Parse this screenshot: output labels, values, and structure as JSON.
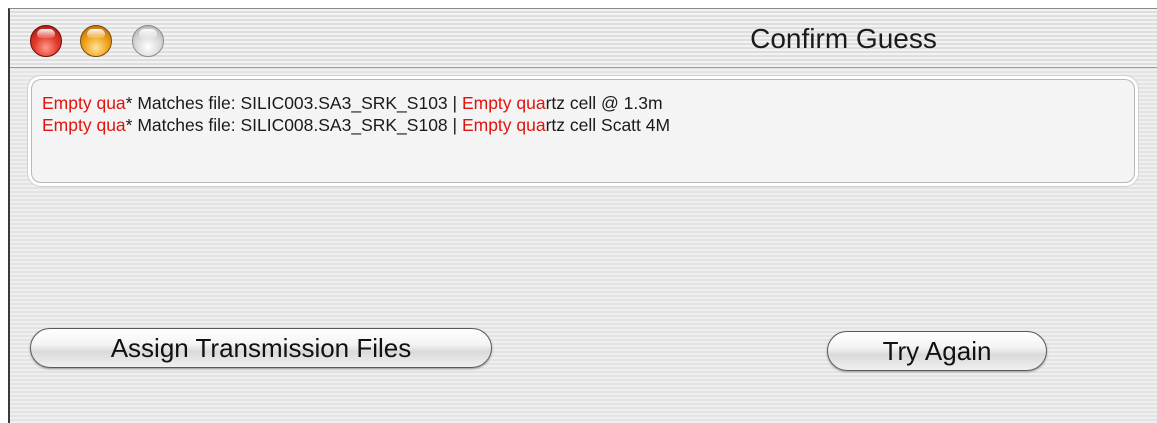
{
  "window": {
    "title": "Confirm Guess"
  },
  "matches": [
    {
      "highlight_prefix": "Empty qua",
      "marker": "*",
      "matches_label": " Matches file: ",
      "filename": "SILIC003.SA3_SRK_S103",
      "separator": " | ",
      "description_highlight": "Empty qua",
      "description_rest": "rtz cell @ 1.3m"
    },
    {
      "highlight_prefix": "Empty qua",
      "marker": "*",
      "matches_label": " Matches file: ",
      "filename": "SILIC008.SA3_SRK_S108",
      "separator": " | ",
      "description_highlight": "Empty qua",
      "description_rest": "rtz cell Scatt 4M"
    }
  ],
  "buttons": {
    "assign_label": "Assign Transmission Files",
    "try_again_label": "Try Again"
  },
  "colors": {
    "highlight": "#e0140f",
    "close_button": "#e23b2c",
    "minimize_button": "#f2a31d",
    "zoom_button": "#d7d7d7"
  },
  "icons": [
    "close-icon",
    "minimize-icon",
    "zoom-icon"
  ]
}
